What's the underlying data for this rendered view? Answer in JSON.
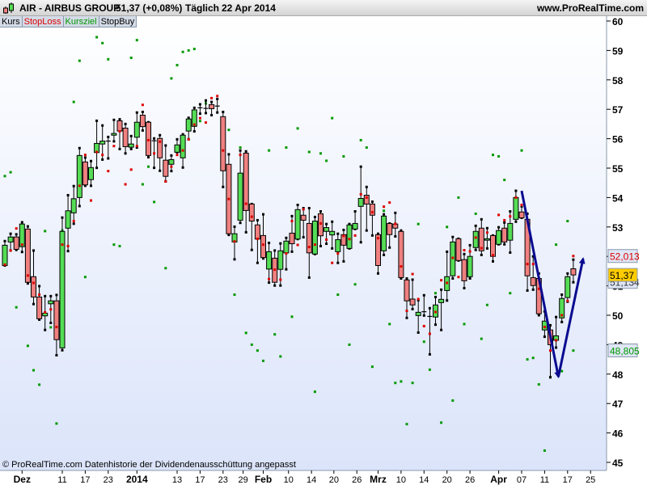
{
  "header": {
    "title": "AIR - AIRBUS GROUP",
    "price": "51,37 (+0,08%)",
    "period": "Täglich",
    "date": "22 Apr 2014",
    "site": "www.ProRealTime.com"
  },
  "tabs": [
    {
      "label": "Kurs",
      "color": "#000000"
    },
    {
      "label": "StopLoss",
      "color": "#dd0000"
    },
    {
      "label": "Kursziel",
      "color": "#009900"
    },
    {
      "label": "StopBuy",
      "color": "#000000"
    }
  ],
  "footer": "© ProRealTime.com  Datenhistorie der Dividendenausschüttung angepasst",
  "colors": {
    "up": "#55dd55",
    "down": "#f08080",
    "stop": "#dd0000",
    "target": "#009900",
    "arrow": "#0a0a90",
    "bg_top": "#ffffff",
    "bg_bottom": "#dbe4fa"
  },
  "price_tags": [
    {
      "label": "52,013",
      "price": 52.013,
      "color": "#dd0000",
      "bg": "#dfe6f5"
    },
    {
      "label": "51,134",
      "price": 51.134,
      "color": "#333333",
      "bg": "#dfe6f5"
    },
    {
      "label": "51,37",
      "price": 51.37,
      "color": "#000000",
      "bg": "#ffcc00"
    },
    {
      "label": "48,805",
      "price": 48.805,
      "color": "#009900",
      "bg": "#dfe6f5"
    }
  ],
  "chart_data": {
    "type": "candlestick",
    "title": "AIR - AIRBUS GROUP Täglich",
    "ylim": [
      44.6,
      60.2
    ],
    "yticks": [
      45,
      46,
      47,
      48,
      49,
      50,
      51,
      52,
      53,
      54,
      55,
      56,
      57,
      58,
      59,
      60
    ],
    "xticks": [
      {
        "label": "Dez",
        "at": 3,
        "bold": true
      },
      {
        "label": "11",
        "at": 10
      },
      {
        "label": "17",
        "at": 14
      },
      {
        "label": "23",
        "at": 18
      },
      {
        "label": "2014",
        "at": 23,
        "bold": true
      },
      {
        "label": "13",
        "at": 30
      },
      {
        "label": "17",
        "at": 34
      },
      {
        "label": "23",
        "at": 38
      },
      {
        "label": "29",
        "at": 41.5
      },
      {
        "label": "Feb",
        "at": 45,
        "bold": true
      },
      {
        "label": "10",
        "at": 49.4
      },
      {
        "label": "14",
        "at": 53.4
      },
      {
        "label": "20",
        "at": 57.3
      },
      {
        "label": "26",
        "at": 61.3
      },
      {
        "label": "Mrz",
        "at": 65,
        "bold": true
      },
      {
        "label": "10",
        "at": 69
      },
      {
        "label": "14",
        "at": 73
      },
      {
        "label": "20",
        "at": 77
      },
      {
        "label": "26",
        "at": 81
      },
      {
        "label": "Apr",
        "at": 86,
        "bold": true
      },
      {
        "label": "07",
        "at": 90
      },
      {
        "label": "11",
        "at": 94
      },
      {
        "label": "17",
        "at": 98
      },
      {
        "label": "25",
        "at": 102
      }
    ],
    "ohlc": [
      [
        51.69,
        52.52,
        51.69,
        52.38
      ],
      [
        52.49,
        52.77,
        52.2,
        52.66
      ],
      [
        52.66,
        52.75,
        52.22,
        52.24
      ],
      [
        52.33,
        53.16,
        52.15,
        53.1
      ],
      [
        52.93,
        53.02,
        51.08,
        51.12
      ],
      [
        51.31,
        52.2,
        50.38,
        50.62
      ],
      [
        50.62,
        50.99,
        49.85,
        49.88
      ],
      [
        49.98,
        50.65,
        49.5,
        50.07
      ],
      [
        50.39,
        50.65,
        49.74,
        50.49
      ],
      [
        50.49,
        50.69,
        48.64,
        49.17
      ],
      [
        48.89,
        53.32,
        48.81,
        52.85
      ],
      [
        52.96,
        54.08,
        52.18,
        53.55
      ],
      [
        53.48,
        54.39,
        53.11,
        53.96
      ],
      [
        54.0,
        55.68,
        53.71,
        55.43
      ],
      [
        55.21,
        55.36,
        54.4,
        54.43
      ],
      [
        54.61,
        55.24,
        54.4,
        55.02
      ],
      [
        55.53,
        56.61,
        55.01,
        55.84
      ],
      [
        55.82,
        56.45,
        55.29,
        55.92
      ],
      [
        55.92,
        56.06,
        55.33,
        55.9
      ],
      [
        56.12,
        56.64,
        55.91,
        56.18
      ],
      [
        56.61,
        56.66,
        55.65,
        56.26
      ],
      [
        56.36,
        56.5,
        55.5,
        55.73
      ],
      [
        55.71,
        56.09,
        55.65,
        55.82
      ],
      [
        56.05,
        56.89,
        55.7,
        56.56
      ],
      [
        56.8,
        56.91,
        56.28,
        56.41
      ],
      [
        56.56,
        56.56,
        55.37,
        55.43
      ],
      [
        55.93,
        56.01,
        55.01,
        55.92
      ],
      [
        56.01,
        56.12,
        54.91,
        55.35
      ],
      [
        55.27,
        55.77,
        54.55,
        54.72
      ],
      [
        55.13,
        55.43,
        54.9,
        55.29
      ],
      [
        55.54,
        55.98,
        55.54,
        55.79
      ],
      [
        55.35,
        56.15,
        55.02,
        56.12
      ],
      [
        56.26,
        56.71,
        55.98,
        56.67
      ],
      [
        56.42,
        57.05,
        56.25,
        56.98
      ],
      [
        57.02,
        57.17,
        56.85,
        57.05
      ],
      [
        57.03,
        57.3,
        56.87,
        57.02
      ],
      [
        57.16,
        57.25,
        56.8,
        57.02
      ],
      [
        57.11,
        57.35,
        56.89,
        57.11
      ],
      [
        56.75,
        56.91,
        54.36,
        54.91
      ],
      [
        55.13,
        55.47,
        52.73,
        52.77
      ],
      [
        52.49,
        53.01,
        51.9,
        52.77
      ],
      [
        53.23,
        55.6,
        53.14,
        54.83
      ],
      [
        55.51,
        55.57,
        52.82,
        53.56
      ],
      [
        53.78,
        53.78,
        52.22,
        53.2
      ],
      [
        53.07,
        53.23,
        51.78,
        52.59
      ],
      [
        52.71,
        53.43,
        51.93,
        51.96
      ],
      [
        51.57,
        52.46,
        51.11,
        52.16
      ],
      [
        51.94,
        52.2,
        51.01,
        51.12
      ],
      [
        51.56,
        52.44,
        51.01,
        52.19
      ],
      [
        52.12,
        52.63,
        51.56,
        52.52
      ],
      [
        52.79,
        53.37,
        52.16,
        52.43
      ],
      [
        52.59,
        53.75,
        52.59,
        53.59
      ],
      [
        53.4,
        53.64,
        52.65,
        53.23
      ],
      [
        53.12,
        53.64,
        51.28,
        52.12
      ],
      [
        52.08,
        53.34,
        52.08,
        53.2
      ],
      [
        53.45,
        53.53,
        52.35,
        52.7
      ],
      [
        52.85,
        53.1,
        52.43,
        52.98
      ],
      [
        52.73,
        53.18,
        52.27,
        52.85
      ],
      [
        52.16,
        52.77,
        51.78,
        52.57
      ],
      [
        52.74,
        52.9,
        51.83,
        52.38
      ],
      [
        52.27,
        53.1,
        52.27,
        53.07
      ],
      [
        52.93,
        53.53,
        52.93,
        53.12
      ],
      [
        53.7,
        55.05,
        52.48,
        53.97
      ],
      [
        54.08,
        54.36,
        52.88,
        53.78
      ],
      [
        53.78,
        53.86,
        52.71,
        53.4
      ],
      [
        52.74,
        52.77,
        51.42,
        51.69
      ],
      [
        52.19,
        53.43,
        52.05,
        53.37
      ],
      [
        53.12,
        53.12,
        52.3,
        52.74
      ],
      [
        53.1,
        53.48,
        52.68,
        52.96
      ],
      [
        52.85,
        52.88,
        51.25,
        51.28
      ],
      [
        51.2,
        51.25,
        49.91,
        50.49
      ],
      [
        50.55,
        51.21,
        50.21,
        50.35
      ],
      [
        49.99,
        50.51,
        49.41,
        50.1
      ],
      [
        50.12,
        50.68,
        49.99,
        50.12
      ],
      [
        49.96,
        50.24,
        48.67,
        49.95
      ],
      [
        49.94,
        50.62,
        49.68,
        50.35
      ],
      [
        50.43,
        50.87,
        49.5,
        50.54
      ],
      [
        50.84,
        52.16,
        50.5,
        51.31
      ],
      [
        51.34,
        52.66,
        51.25,
        52.49
      ],
      [
        52.6,
        52.6,
        51.86,
        51.86
      ],
      [
        51.89,
        52.08,
        50.92,
        51.17
      ],
      [
        51.31,
        52.38,
        51.25,
        52.0
      ],
      [
        52.3,
        53.04,
        52.22,
        52.85
      ],
      [
        52.96,
        53.26,
        52.05,
        52.19
      ],
      [
        52.55,
        52.96,
        52.27,
        52.6
      ],
      [
        52.71,
        52.71,
        51.83,
        52.0
      ],
      [
        52.41,
        52.99,
        52.41,
        52.88
      ],
      [
        52.96,
        53.15,
        52.41,
        52.49
      ],
      [
        52.55,
        53.53,
        52.13,
        53.12
      ],
      [
        53.26,
        54.23,
        53.18,
        54.0
      ],
      [
        53.51,
        53.7,
        53.31,
        53.31
      ],
      [
        53.26,
        53.45,
        50.84,
        51.34
      ],
      [
        51.28,
        52.0,
        50.87,
        51.01
      ],
      [
        51.25,
        51.42,
        50.0,
        50.05
      ],
      [
        49.5,
        50.13,
        49.27,
        49.8
      ],
      [
        49.5,
        49.66,
        47.89,
        49.0
      ],
      [
        49.15,
        49.94,
        48.9,
        49.3
      ],
      [
        49.91,
        50.7,
        49.77,
        50.57
      ],
      [
        50.6,
        51.42,
        50.46,
        51.31
      ],
      [
        51.58,
        51.89,
        51.12,
        51.37
      ]
    ],
    "stoploss": [
      [
        0,
        51.72
      ],
      [
        1,
        52.2
      ],
      [
        2,
        52.95
      ],
      [
        3,
        52.4
      ],
      [
        4,
        51.35
      ],
      [
        5,
        51.1
      ],
      [
        6,
        50.7
      ],
      [
        7,
        50.1
      ],
      [
        8,
        50.2
      ],
      [
        9,
        49.6
      ],
      [
        10,
        52.4
      ],
      [
        11,
        52.35
      ],
      [
        12,
        53.2
      ],
      [
        13,
        54.4
      ],
      [
        14,
        55.45
      ],
      [
        15,
        53.9
      ],
      [
        16,
        55.55
      ],
      [
        17,
        55.45
      ],
      [
        18,
        54.9
      ],
      [
        19,
        55.75
      ],
      [
        20,
        56.25
      ],
      [
        21,
        54.45
      ],
      [
        22,
        54.95
      ],
      [
        23,
        55.75
      ],
      [
        24,
        57.15
      ],
      [
        25,
        55.95
      ],
      [
        26,
        55.5
      ],
      [
        27,
        55.9
      ],
      [
        28,
        54.55
      ],
      [
        29,
        55.05
      ],
      [
        30,
        55.45
      ],
      [
        31,
        55.6
      ],
      [
        32,
        55.98
      ],
      [
        33,
        56.48
      ],
      [
        34,
        56.7
      ],
      [
        35,
        56.55
      ],
      [
        36,
        57.38
      ],
      [
        37,
        57.45
      ],
      [
        38,
        55.6
      ],
      [
        39,
        53.95
      ],
      [
        40,
        52.51
      ],
      [
        41,
        55.45
      ],
      [
        42,
        53.79
      ],
      [
        43,
        53.35
      ],
      [
        44,
        52.6
      ],
      [
        45,
        52.4
      ],
      [
        46,
        51.23
      ],
      [
        47,
        51.55
      ],
      [
        48,
        51.21
      ],
      [
        49,
        52.1
      ],
      [
        50,
        53.2
      ],
      [
        51,
        52.39
      ],
      [
        52,
        53.6
      ],
      [
        53,
        52.32
      ],
      [
        54,
        52.4
      ],
      [
        55,
        53.12
      ],
      [
        56,
        52.57
      ],
      [
        57,
        51.78
      ],
      [
        58,
        52.1
      ],
      [
        59,
        52.7
      ],
      [
        60,
        52.59
      ],
      [
        61,
        52.71
      ],
      [
        62,
        54.11
      ],
      [
        63,
        54.0
      ],
      [
        64,
        53.5
      ],
      [
        65,
        52.62
      ],
      [
        66,
        53.69
      ],
      [
        67,
        53.83
      ],
      [
        68,
        53.11
      ],
      [
        69,
        51.66
      ],
      [
        70,
        50.15
      ],
      [
        71,
        51.4
      ],
      [
        72,
        50.55
      ],
      [
        73,
        49.63
      ],
      [
        74,
        49.37
      ],
      [
        75,
        50.11
      ],
      [
        76,
        51.19
      ],
      [
        77,
        51.1
      ],
      [
        78,
        51.95
      ],
      [
        79,
        51.3
      ],
      [
        80,
        52.21
      ],
      [
        81,
        52.17
      ],
      [
        82,
        52.64
      ],
      [
        83,
        52.28
      ],
      [
        84,
        52.81
      ],
      [
        85,
        52.04
      ],
      [
        86,
        53.41
      ],
      [
        87,
        53.23
      ],
      [
        88,
        53.36
      ],
      [
        89,
        54.0
      ],
      [
        90,
        53.75
      ],
      [
        91,
        51.74
      ],
      [
        92,
        51.74
      ],
      [
        93,
        50.9
      ],
      [
        94,
        49.6
      ],
      [
        95,
        48.8
      ],
      [
        96,
        49.15
      ],
      [
        97,
        50.0
      ],
      [
        98,
        50.49
      ],
      [
        99,
        52.013
      ]
    ],
    "kursziel": [
      [
        0,
        54.73
      ],
      [
        1,
        54.86
      ],
      [
        2,
        50.27
      ],
      [
        3,
        52.91
      ],
      [
        4,
        48.96
      ],
      [
        5,
        48.13
      ],
      [
        6,
        47.64
      ],
      [
        7,
        52.86
      ],
      [
        8,
        49.59
      ],
      [
        9,
        46.32
      ],
      [
        10,
        52.88
      ],
      [
        12,
        57.25
      ],
      [
        13,
        58.65
      ],
      [
        14,
        51.3
      ],
      [
        15,
        53.9
      ],
      [
        16,
        59.45
      ],
      [
        17,
        59.25
      ],
      [
        18,
        58.7
      ],
      [
        19,
        52.4
      ],
      [
        20,
        52.35
      ],
      [
        22,
        58.75
      ],
      [
        23,
        59.35
      ],
      [
        24,
        54.45
      ],
      [
        25,
        55.05
      ],
      [
        26,
        53.85
      ],
      [
        28,
        51.6
      ],
      [
        29,
        58.05
      ],
      [
        30,
        58.5
      ],
      [
        31,
        58.95
      ],
      [
        32,
        59.0
      ],
      [
        33,
        59.05
      ],
      [
        34,
        56.6
      ],
      [
        35,
        57.2
      ],
      [
        38,
        55.2
      ],
      [
        39,
        56.3
      ],
      [
        40,
        50.7
      ],
      [
        41,
        55.7
      ],
      [
        42,
        49.4
      ],
      [
        43,
        49.0
      ],
      [
        44,
        48.8
      ],
      [
        45,
        48.45
      ],
      [
        46,
        55.6
      ],
      [
        47,
        49.35
      ],
      [
        48,
        48.6
      ],
      [
        49,
        55.7
      ],
      [
        50,
        49.95
      ],
      [
        51,
        56.35
      ],
      [
        53,
        55.55
      ],
      [
        54,
        47.4
      ],
      [
        55,
        55.5
      ],
      [
        56,
        55.25
      ],
      [
        57,
        56.7
      ],
      [
        58,
        50.7
      ],
      [
        59,
        55.4
      ],
      [
        60,
        49.0
      ],
      [
        61,
        51.05
      ],
      [
        62,
        55.95
      ],
      [
        63,
        55.7
      ],
      [
        64,
        48.25
      ],
      [
        66,
        53.55
      ],
      [
        67,
        49.7
      ],
      [
        68,
        47.7
      ],
      [
        69,
        47.75
      ],
      [
        70,
        46.3
      ],
      [
        71,
        47.7
      ],
      [
        72,
        53.1
      ],
      [
        73,
        49.1
      ],
      [
        74,
        48.15
      ],
      [
        75,
        50.75
      ],
      [
        76,
        46.35
      ],
      [
        77,
        53.0
      ],
      [
        78,
        47.1
      ],
      [
        79,
        54.0
      ],
      [
        80,
        49.7
      ],
      [
        82,
        53.45
      ],
      [
        83,
        49.2
      ],
      [
        84,
        50.35
      ],
      [
        85,
        55.45
      ],
      [
        86,
        55.4
      ],
      [
        87,
        54.6
      ],
      [
        88,
        50.75
      ],
      [
        89,
        54.0
      ],
      [
        90,
        55.6
      ],
      [
        91,
        48.5
      ],
      [
        92,
        48.55
      ],
      [
        93,
        47.65
      ],
      [
        94,
        45.4
      ],
      [
        95,
        47.9
      ],
      [
        96,
        52.4
      ],
      [
        97,
        48.1
      ],
      [
        98,
        53.2
      ],
      [
        99,
        48.8
      ]
    ],
    "trend_arrows": [
      {
        "from": [
          90,
          54.23
        ],
        "to": [
          96.4,
          47.91
        ]
      },
      {
        "from": [
          96.4,
          47.91
        ],
        "to": [
          100.7,
          51.92
        ]
      }
    ]
  }
}
